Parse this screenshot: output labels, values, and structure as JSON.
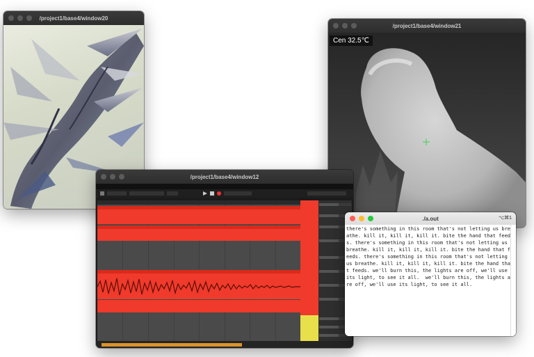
{
  "windows": {
    "window20": {
      "title": "/project1/base4/window20"
    },
    "window21": {
      "title": "/project1/base4/window21",
      "temperature_label": "Cen  32.5℃"
    },
    "window12": {
      "title": "/project1/base4/window12",
      "accent_red": "#f03a2b",
      "accent_yellow": "#e8e04a"
    },
    "terminal": {
      "title": "./a.out",
      "shortcut": "⌥⌘1",
      "output": "there's something in this room that's not letting us breathe. kill it, kill it, kill it. bite the hand that feeds. there's something in this room that's not letting us breathe. kill it, kill it, kill it. bite the hand that feeds. there's something in this room that's not letting us breathe. kill it, kill it, kill it. bite the hand that feeds. we'll burn this, the lights are off, we'll use its light, to see it all.  we'll burn this, the lights are off, we'll use its light, to see it all."
    }
  }
}
